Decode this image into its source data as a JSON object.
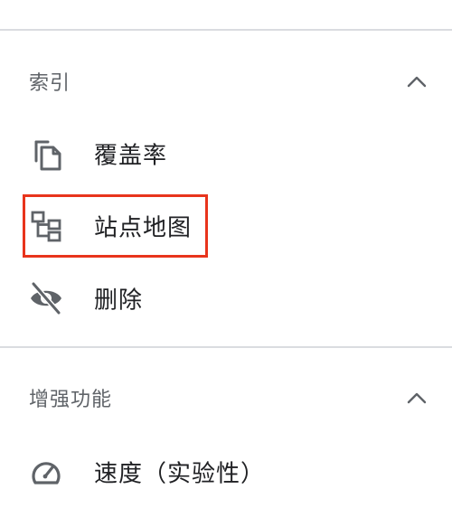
{
  "sections": [
    {
      "title": "索引",
      "collapse_icon": "chevron-up-icon",
      "items": [
        {
          "label": "覆盖率",
          "icon": "copy-icon"
        },
        {
          "label": "站点地图",
          "icon": "sitemap-icon",
          "highlighted": true
        },
        {
          "label": "删除",
          "icon": "eye-off-icon"
        }
      ]
    },
    {
      "title": "增强功能",
      "collapse_icon": "chevron-up-icon",
      "items": [
        {
          "label": "速度（实验性）",
          "icon": "speedometer-icon"
        }
      ]
    }
  ],
  "colors": {
    "divider": "#dadce0",
    "section_title": "#5f6368",
    "item_label": "#202124",
    "icon": "#5f6368",
    "highlight": "#e8341c"
  }
}
